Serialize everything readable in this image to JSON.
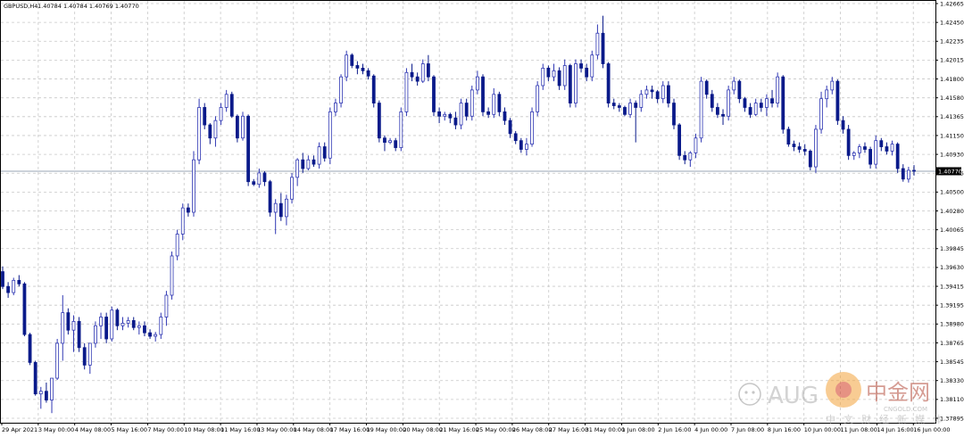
{
  "header": {
    "symbol": "GBPUSD,H4",
    "ohlc": "1.40784 1.40784 1.40769 1.40770"
  },
  "current_price_label": "1.40770",
  "watermark": {
    "text": "AUG",
    "site_name": "中金网",
    "site_url": "CNGOLD.COM",
    "site_tagline": "中文财经新媒体"
  },
  "colors": {
    "bull": "#2f37b3",
    "bear": "#0a1a8a",
    "grid": "#c8c8c8",
    "price_line": "#9aa4b4"
  },
  "chart_data": {
    "type": "candlestick",
    "symbol": "GBPUSD",
    "timeframe": "H4",
    "ylim": [
      1.3789,
      1.4272
    ],
    "y_ticks": [
      "1.42665",
      "1.42450",
      "1.42235",
      "1.42015",
      "1.41800",
      "1.41580",
      "1.41365",
      "1.41150",
      "1.40930",
      "1.40715",
      "1.40500",
      "1.40280",
      "1.40065",
      "1.39845",
      "1.39630",
      "1.39415",
      "1.39195",
      "1.38980",
      "1.38765",
      "1.38545",
      "1.38330",
      "1.38110",
      "1.37895"
    ],
    "x_labels": [
      "29 Apr 2021",
      "3 May 00:00",
      "4 May 08:00",
      "5 May 16:00",
      "7 May 00:00",
      "10 May 08:00",
      "11 May 16:00",
      "13 May 00:00",
      "14 May 08:00",
      "17 May 16:00",
      "19 May 00:00",
      "20 May 08:00",
      "21 May 16:00",
      "25 May 00:00",
      "26 May 08:00",
      "27 May 16:00",
      "31 May 00:00",
      "1 Jun 08:00",
      "2 Jun 16:00",
      "4 Jun 00:00",
      "7 Jun 08:00",
      "8 Jun 16:00",
      "10 Jun 00:00",
      "11 Jun 08:00",
      "14 Jun 16:00",
      "16 Jun 00:00"
    ],
    "last_price": 1.4077,
    "candles": [
      [
        1.3962,
        1.3968,
        1.3942,
        1.3945
      ],
      [
        1.3945,
        1.395,
        1.3932,
        1.3938
      ],
      [
        1.3938,
        1.3955,
        1.3935,
        1.3952
      ],
      [
        1.3952,
        1.3958,
        1.3945,
        1.3948
      ],
      [
        1.3948,
        1.395,
        1.3888,
        1.389
      ],
      [
        1.389,
        1.3892,
        1.3855,
        1.3858
      ],
      [
        1.3858,
        1.386,
        1.382,
        1.3822
      ],
      [
        1.3822,
        1.383,
        1.3805,
        1.3825
      ],
      [
        1.3825,
        1.3835,
        1.3812,
        1.3815
      ],
      [
        1.3815,
        1.3818,
        1.38,
        1.384
      ],
      [
        1.384,
        1.3885,
        1.3838,
        1.388
      ],
      [
        1.388,
        1.3935,
        1.386,
        1.3915
      ],
      [
        1.3915,
        1.392,
        1.389,
        1.3895
      ],
      [
        1.3895,
        1.3912,
        1.387,
        1.3905
      ],
      [
        1.3905,
        1.391,
        1.387,
        1.3875
      ],
      [
        1.3875,
        1.388,
        1.385,
        1.3855
      ],
      [
        1.3855,
        1.386,
        1.3845,
        1.388
      ],
      [
        1.388,
        1.3905,
        1.3875,
        1.39
      ],
      [
        1.39,
        1.3915,
        1.3885,
        1.391
      ],
      [
        1.391,
        1.3915,
        1.388,
        1.3885
      ],
      [
        1.3885,
        1.3922,
        1.3882,
        1.3918
      ],
      [
        1.3918,
        1.392,
        1.3895,
        1.39
      ],
      [
        1.39,
        1.391,
        1.3895,
        1.3903
      ],
      [
        1.3903,
        1.391,
        1.3898,
        1.3906
      ],
      [
        1.3906,
        1.391,
        1.3895,
        1.3898
      ],
      [
        1.3898,
        1.3905,
        1.389,
        1.39
      ],
      [
        1.39,
        1.3905,
        1.3888,
        1.3892
      ],
      [
        1.3892,
        1.3896,
        1.3885,
        1.3888
      ],
      [
        1.3888,
        1.3893,
        1.3882,
        1.389
      ],
      [
        1.389,
        1.3915,
        1.3885,
        1.391
      ],
      [
        1.391,
        1.394,
        1.39,
        1.3935
      ],
      [
        1.3935,
        1.3985,
        1.393,
        1.398
      ],
      [
        1.398,
        1.401,
        1.3975,
        1.4005
      ],
      [
        1.4005,
        1.404,
        1.3998,
        1.4035
      ],
      [
        1.4035,
        1.404,
        1.4025,
        1.403
      ],
      [
        1.403,
        1.41,
        1.4025,
        1.409
      ],
      [
        1.409,
        1.416,
        1.4085,
        1.415
      ],
      [
        1.415,
        1.4155,
        1.4125,
        1.413
      ],
      [
        1.413,
        1.4132,
        1.4108,
        1.4115
      ],
      [
        1.4115,
        1.414,
        1.4105,
        1.4135
      ],
      [
        1.4135,
        1.4155,
        1.413,
        1.415
      ],
      [
        1.415,
        1.417,
        1.4145,
        1.4165
      ],
      [
        1.4165,
        1.4168,
        1.4138,
        1.414
      ],
      [
        1.414,
        1.4142,
        1.411,
        1.4115
      ],
      [
        1.4115,
        1.4145,
        1.4112,
        1.414
      ],
      [
        1.414,
        1.4142,
        1.406,
        1.4065
      ],
      [
        1.4065,
        1.4068,
        1.406,
        1.4062
      ],
      [
        1.4062,
        1.408,
        1.4058,
        1.4075
      ],
      [
        1.4075,
        1.4077,
        1.406,
        1.4065
      ],
      [
        1.4065,
        1.4067,
        1.4025,
        1.403
      ],
      [
        1.403,
        1.4045,
        1.4005,
        1.404
      ],
      [
        1.404,
        1.4052,
        1.402,
        1.4025
      ],
      [
        1.4025,
        1.405,
        1.4015,
        1.4045
      ],
      [
        1.4045,
        1.4075,
        1.404,
        1.407
      ],
      [
        1.407,
        1.4092,
        1.406,
        1.409
      ],
      [
        1.409,
        1.4098,
        1.4075,
        1.408
      ],
      [
        1.408,
        1.4095,
        1.4078,
        1.409
      ],
      [
        1.409,
        1.4095,
        1.4082,
        1.4085
      ],
      [
        1.4085,
        1.411,
        1.408,
        1.4105
      ],
      [
        1.4105,
        1.411,
        1.4088,
        1.4092
      ],
      [
        1.4092,
        1.415,
        1.4085,
        1.4145
      ],
      [
        1.4145,
        1.416,
        1.414,
        1.4155
      ],
      [
        1.4155,
        1.4188,
        1.415,
        1.4185
      ],
      [
        1.4185,
        1.4215,
        1.418,
        1.421
      ],
      [
        1.421,
        1.4212,
        1.4195,
        1.4198
      ],
      [
        1.4198,
        1.4203,
        1.4188,
        1.4195
      ],
      [
        1.4195,
        1.42,
        1.4188,
        1.4192
      ],
      [
        1.4192,
        1.4195,
        1.4182,
        1.4186
      ],
      [
        1.4186,
        1.4188,
        1.415,
        1.4155
      ],
      [
        1.4155,
        1.4158,
        1.411,
        1.4115
      ],
      [
        1.4115,
        1.4118,
        1.41,
        1.411
      ],
      [
        1.411,
        1.4115,
        1.4108,
        1.4112
      ],
      [
        1.4112,
        1.4115,
        1.41,
        1.4104
      ],
      [
        1.4104,
        1.415,
        1.41,
        1.4145
      ],
      [
        1.4145,
        1.4195,
        1.414,
        1.419
      ],
      [
        1.419,
        1.42,
        1.418,
        1.4185
      ],
      [
        1.4185,
        1.419,
        1.4175,
        1.418
      ],
      [
        1.418,
        1.4205,
        1.4178,
        1.42
      ],
      [
        1.42,
        1.421,
        1.418,
        1.4185
      ],
      [
        1.4185,
        1.4187,
        1.414,
        1.4145
      ],
      [
        1.4145,
        1.415,
        1.4132,
        1.414
      ],
      [
        1.414,
        1.4145,
        1.4135,
        1.4142
      ],
      [
        1.4142,
        1.4144,
        1.4132,
        1.4138
      ],
      [
        1.4138,
        1.4145,
        1.4125,
        1.413
      ],
      [
        1.413,
        1.416,
        1.4125,
        1.4155
      ],
      [
        1.4155,
        1.416,
        1.4135,
        1.414
      ],
      [
        1.414,
        1.4175,
        1.4135,
        1.417
      ],
      [
        1.417,
        1.4192,
        1.4165,
        1.4185
      ],
      [
        1.4185,
        1.4188,
        1.414,
        1.4145
      ],
      [
        1.4145,
        1.415,
        1.4138,
        1.4142
      ],
      [
        1.4142,
        1.4172,
        1.4138,
        1.4165
      ],
      [
        1.4165,
        1.4168,
        1.414,
        1.4145
      ],
      [
        1.4145,
        1.415,
        1.413,
        1.4135
      ],
      [
        1.4135,
        1.4138,
        1.4115,
        1.412
      ],
      [
        1.412,
        1.4123,
        1.4108,
        1.4112
      ],
      [
        1.4112,
        1.4115,
        1.4098,
        1.4102
      ],
      [
        1.4102,
        1.4115,
        1.4095,
        1.4108
      ],
      [
        1.4108,
        1.415,
        1.4105,
        1.4145
      ],
      [
        1.4145,
        1.418,
        1.414,
        1.4175
      ],
      [
        1.4175,
        1.42,
        1.417,
        1.4195
      ],
      [
        1.4195,
        1.4198,
        1.418,
        1.4185
      ],
      [
        1.4185,
        1.42,
        1.418,
        1.4192
      ],
      [
        1.4192,
        1.4196,
        1.417,
        1.4175
      ],
      [
        1.4175,
        1.4205,
        1.417,
        1.4198
      ],
      [
        1.4198,
        1.42,
        1.415,
        1.4155
      ],
      [
        1.4155,
        1.4205,
        1.415,
        1.42
      ],
      [
        1.42,
        1.4205,
        1.419,
        1.4195
      ],
      [
        1.4195,
        1.42,
        1.418,
        1.4185
      ],
      [
        1.4185,
        1.4215,
        1.418,
        1.421
      ],
      [
        1.421,
        1.4245,
        1.4205,
        1.4235
      ],
      [
        1.4235,
        1.4255,
        1.4195,
        1.42
      ],
      [
        1.42,
        1.4202,
        1.415,
        1.4155
      ],
      [
        1.4155,
        1.416,
        1.4148,
        1.4152
      ],
      [
        1.4152,
        1.4155,
        1.4145,
        1.415
      ],
      [
        1.415,
        1.4152,
        1.414,
        1.4142
      ],
      [
        1.4142,
        1.416,
        1.4138,
        1.4155
      ],
      [
        1.4155,
        1.4158,
        1.411,
        1.415
      ],
      [
        1.415,
        1.417,
        1.4145,
        1.4165
      ],
      [
        1.4165,
        1.4175,
        1.416,
        1.417
      ],
      [
        1.417,
        1.4175,
        1.416,
        1.4168
      ],
      [
        1.4168,
        1.417,
        1.4155,
        1.416
      ],
      [
        1.416,
        1.418,
        1.4155,
        1.4175
      ],
      [
        1.4175,
        1.418,
        1.415,
        1.4155
      ],
      [
        1.4155,
        1.416,
        1.4125,
        1.413
      ],
      [
        1.413,
        1.4132,
        1.409,
        1.4095
      ],
      [
        1.4095,
        1.41,
        1.4085,
        1.409
      ],
      [
        1.409,
        1.41,
        1.4082,
        1.4098
      ],
      [
        1.4098,
        1.412,
        1.4092,
        1.4115
      ],
      [
        1.4115,
        1.4185,
        1.411,
        1.418
      ],
      [
        1.418,
        1.4182,
        1.416,
        1.4165
      ],
      [
        1.4165,
        1.417,
        1.4145,
        1.415
      ],
      [
        1.415,
        1.4155,
        1.4138,
        1.4142
      ],
      [
        1.4142,
        1.4148,
        1.413,
        1.414
      ],
      [
        1.414,
        1.4175,
        1.4135,
        1.417
      ],
      [
        1.417,
        1.4185,
        1.4165,
        1.418
      ],
      [
        1.418,
        1.4182,
        1.4155,
        1.416
      ],
      [
        1.416,
        1.4162,
        1.4145,
        1.415
      ],
      [
        1.415,
        1.4155,
        1.4138,
        1.4142
      ],
      [
        1.4142,
        1.416,
        1.414,
        1.4155
      ],
      [
        1.4155,
        1.416,
        1.4145,
        1.415
      ],
      [
        1.415,
        1.4165,
        1.414,
        1.416
      ],
      [
        1.416,
        1.417,
        1.415,
        1.4155
      ],
      [
        1.4155,
        1.419,
        1.415,
        1.4185
      ],
      [
        1.4185,
        1.4187,
        1.412,
        1.4125
      ],
      [
        1.4125,
        1.4128,
        1.4105,
        1.4108
      ],
      [
        1.4108,
        1.4112,
        1.41,
        1.4105
      ],
      [
        1.4105,
        1.411,
        1.4098,
        1.4102
      ],
      [
        1.4102,
        1.4108,
        1.4095,
        1.41
      ],
      [
        1.41,
        1.4102,
        1.4078,
        1.4082
      ],
      [
        1.4082,
        1.413,
        1.4075,
        1.4125
      ],
      [
        1.4125,
        1.4168,
        1.412,
        1.416
      ],
      [
        1.416,
        1.4175,
        1.415,
        1.417
      ],
      [
        1.417,
        1.4185,
        1.4165,
        1.418
      ],
      [
        1.418,
        1.4182,
        1.413,
        1.4135
      ],
      [
        1.4135,
        1.414,
        1.412,
        1.4125
      ],
      [
        1.4125,
        1.413,
        1.409,
        1.4095
      ],
      [
        1.4095,
        1.41,
        1.409,
        1.4098
      ],
      [
        1.4098,
        1.4108,
        1.4092,
        1.4105
      ],
      [
        1.4105,
        1.411,
        1.4098,
        1.4102
      ],
      [
        1.4102,
        1.4105,
        1.408,
        1.4085
      ],
      [
        1.4085,
        1.4118,
        1.408,
        1.4112
      ],
      [
        1.4112,
        1.4115,
        1.41,
        1.4105
      ],
      [
        1.4105,
        1.411,
        1.4096,
        1.41
      ],
      [
        1.41,
        1.4112,
        1.4095,
        1.4108
      ],
      [
        1.4108,
        1.411,
        1.4075,
        1.408
      ],
      [
        1.408,
        1.4085,
        1.4065,
        1.4068
      ],
      [
        1.4068,
        1.4082,
        1.4064,
        1.4078
      ],
      [
        1.4078,
        1.4084,
        1.4072,
        1.4077
      ]
    ]
  }
}
